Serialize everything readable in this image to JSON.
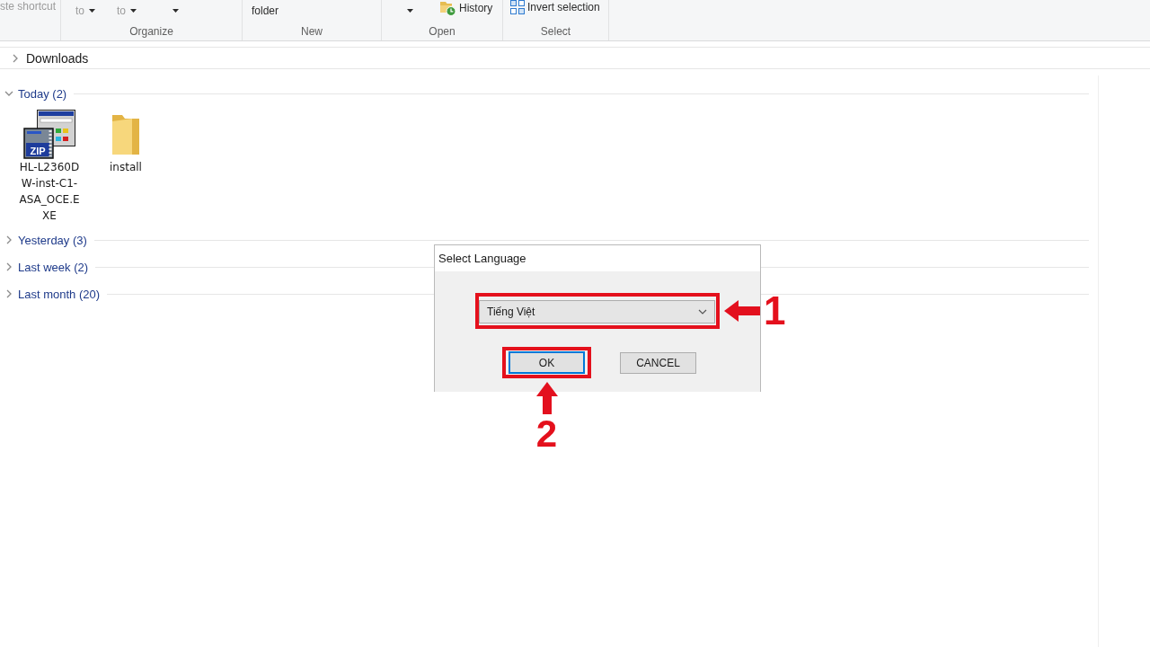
{
  "ribbon": {
    "groups": [
      {
        "commands": [
          {
            "kind": "text",
            "label": "ste shortcut",
            "disabled": true
          }
        ]
      },
      {
        "label": "Organize",
        "commands": [
          {
            "kind": "dropdown",
            "label": "to",
            "disabled": true
          },
          {
            "kind": "dropdown",
            "label": "to",
            "disabled": true
          },
          {
            "kind": "caret",
            "disabled": false
          }
        ]
      },
      {
        "label": "New",
        "commands": [
          {
            "kind": "text",
            "label": "folder",
            "disabled": false
          }
        ]
      },
      {
        "label": "Open",
        "commands": [
          {
            "kind": "caret",
            "disabled": false
          },
          {
            "kind": "icon",
            "label": "History",
            "disabled": false
          }
        ]
      },
      {
        "label": "Select",
        "commands": [
          {
            "kind": "icon",
            "label": "Invert selection",
            "disabled": false
          }
        ]
      }
    ]
  },
  "address_bar": {
    "path": [
      "Downloads"
    ]
  },
  "file_groups": [
    {
      "label": "Today (2)",
      "expanded": true,
      "items": [
        {
          "kind": "installer",
          "name": "HL-L2360DW-inst-C1-ASA_OCE.EXE",
          "badge": "ZIP"
        },
        {
          "kind": "folder",
          "name": "install"
        }
      ]
    },
    {
      "label": "Yesterday (3)",
      "expanded": false
    },
    {
      "label": "Last week (2)",
      "expanded": false
    },
    {
      "label": "Last month (20)",
      "expanded": false
    }
  ],
  "dialog": {
    "title": "Select Language",
    "dropdown": {
      "value": "Tiếng Việt",
      "highlighted": true,
      "step": "1"
    },
    "buttons": [
      {
        "label": "OK",
        "default": true,
        "highlighted": true,
        "step": "2"
      },
      {
        "label": "CANCEL",
        "default": false,
        "highlighted": false
      }
    ]
  }
}
